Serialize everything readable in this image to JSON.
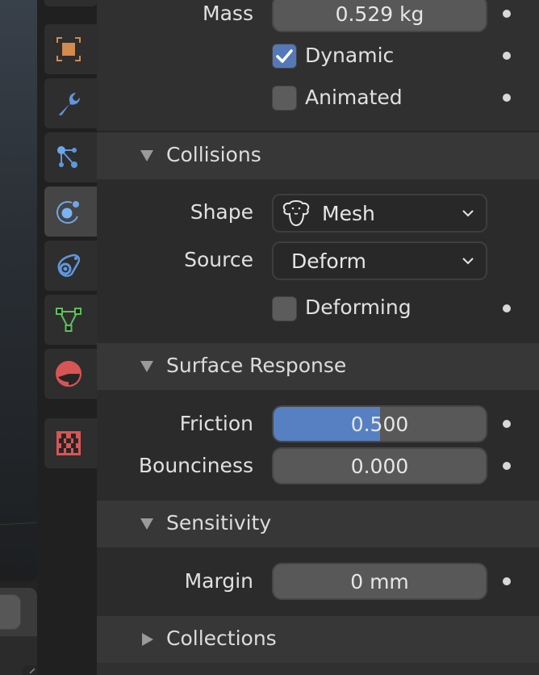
{
  "sidebar_tabs": [
    {
      "name": "object",
      "icon": "object-icon",
      "color": "#e0925a",
      "active": false
    },
    {
      "name": "modifiers",
      "icon": "wrench-icon",
      "color": "#6fa0e0",
      "active": false
    },
    {
      "name": "particles",
      "icon": "particles-icon",
      "color": "#6fa0e0",
      "active": false
    },
    {
      "name": "physics",
      "icon": "physics-icon",
      "color": "#7ab0f0",
      "active": true
    },
    {
      "name": "constraints",
      "icon": "object-constraint-icon",
      "color": "#6fa0e0",
      "active": false
    },
    {
      "name": "data",
      "icon": "mesh-data-icon",
      "color": "#6cc46a",
      "active": false
    },
    {
      "name": "material",
      "icon": "material-icon",
      "color": "#e05a5a",
      "active": false
    },
    {
      "name": "texture",
      "icon": "texture-icon",
      "color": "#e05a5a",
      "active": false
    }
  ],
  "settings": {
    "mass": {
      "label": "Mass",
      "value": "0.529 kg"
    },
    "dynamic": {
      "label": "Dynamic",
      "checked": true
    },
    "animated": {
      "label": "Animated",
      "checked": false
    }
  },
  "collisions": {
    "title": "Collisions",
    "expanded": true,
    "shape": {
      "label": "Shape",
      "value": "Mesh",
      "icon": "mesh-monkey-icon"
    },
    "source": {
      "label": "Source",
      "value": "Deform"
    },
    "deforming": {
      "label": "Deforming",
      "checked": false
    }
  },
  "surface_response": {
    "title": "Surface Response",
    "expanded": true,
    "friction": {
      "label": "Friction",
      "value": "0.500",
      "fill_fraction": 0.5
    },
    "bounciness": {
      "label": "Bounciness",
      "value": "0.000",
      "fill_fraction": 0.0
    }
  },
  "sensitivity": {
    "title": "Sensitivity",
    "expanded": true,
    "margin": {
      "label": "Margin",
      "value": "0 mm"
    }
  },
  "collections": {
    "title": "Collections",
    "expanded": false
  },
  "colors": {
    "accent": "#5680c2",
    "panel_bg": "#303030",
    "section_header_bg": "#373737"
  }
}
